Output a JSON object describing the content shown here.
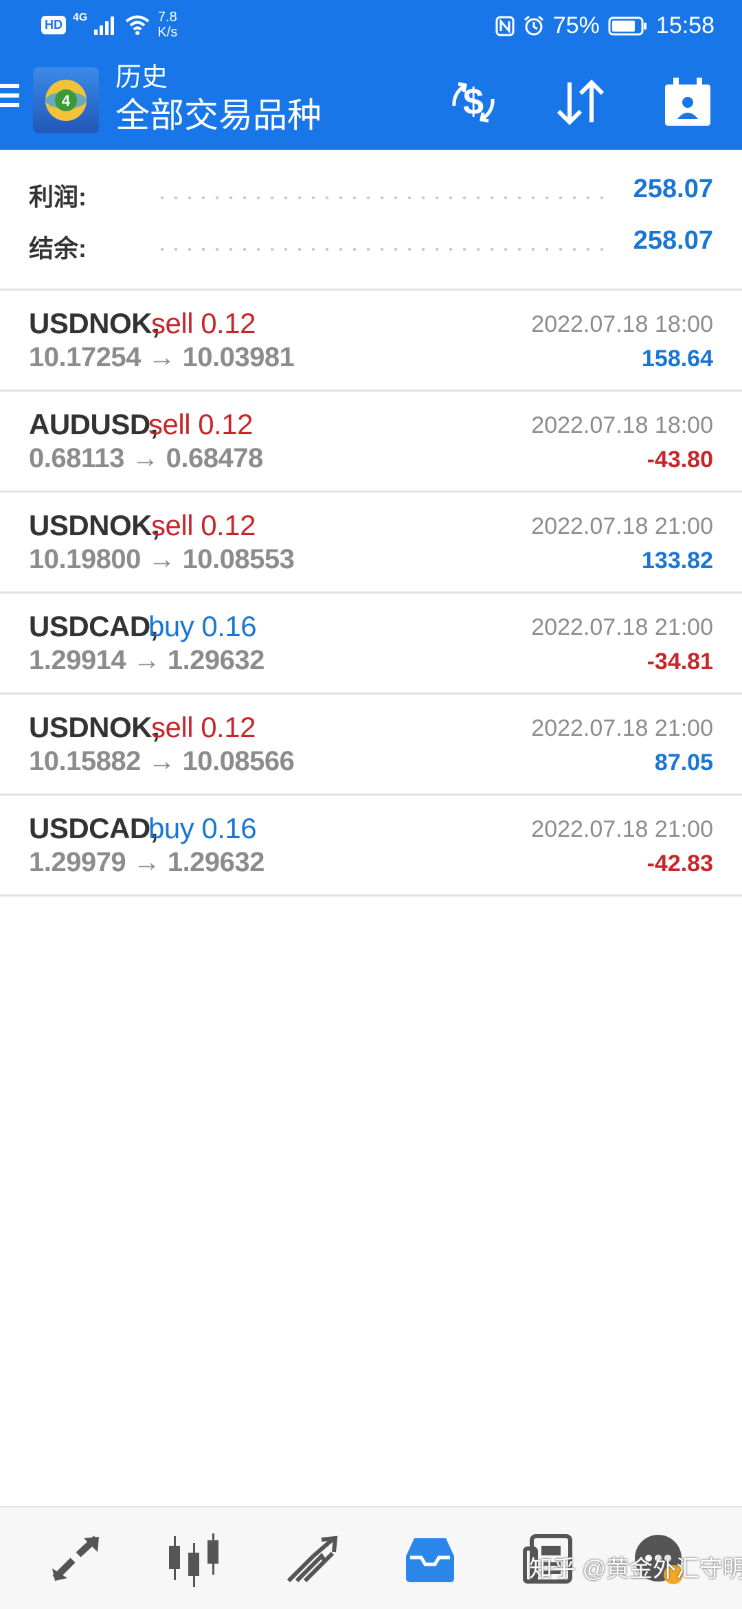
{
  "status_bar": {
    "hd_badge": "HD",
    "network": "4G",
    "speed_value": "7.8",
    "speed_unit": "K/s",
    "battery_percent": "75%",
    "time": "15:58"
  },
  "app_bar": {
    "title_small": "历史",
    "title_big": "全部交易品种",
    "colors": {
      "primary": "#1976e8"
    }
  },
  "summary": {
    "profit_label": "利润:",
    "profit_value": "258.07",
    "balance_label": "结余:",
    "balance_value": "258.07"
  },
  "trades": [
    {
      "symbol": "USDNOK,",
      "side": "sell 0.12",
      "side_type": "sell",
      "prices": "10.17254 → 10.03981",
      "datetime": "2022.07.18 18:00",
      "profit": "158.64",
      "profit_sign": "pos"
    },
    {
      "symbol": "AUDUSD,",
      "side": "sell 0.12",
      "side_type": "sell",
      "prices": "0.68113 → 0.68478",
      "datetime": "2022.07.18 18:00",
      "profit": "-43.80",
      "profit_sign": "neg"
    },
    {
      "symbol": "USDNOK,",
      "side": "sell 0.12",
      "side_type": "sell",
      "prices": "10.19800 → 10.08553",
      "datetime": "2022.07.18 21:00",
      "profit": "133.82",
      "profit_sign": "pos"
    },
    {
      "symbol": "USDCAD,",
      "side": "buy 0.16",
      "side_type": "buy",
      "prices": "1.29914 → 1.29632",
      "datetime": "2022.07.18 21:00",
      "profit": "-34.81",
      "profit_sign": "neg"
    },
    {
      "symbol": "USDNOK,",
      "side": "sell 0.12",
      "side_type": "sell",
      "prices": "10.15882 → 10.08566",
      "datetime": "2022.07.18 21:00",
      "profit": "87.05",
      "profit_sign": "pos"
    },
    {
      "symbol": "USDCAD,",
      "side": "buy 0.16",
      "side_type": "buy",
      "prices": "1.29979 → 1.29632",
      "datetime": "2022.07.18 21:00",
      "profit": "-42.83",
      "profit_sign": "neg"
    }
  ],
  "bottom_nav": {
    "items": [
      "quotes-icon",
      "chart-icon",
      "trade-icon",
      "history-icon",
      "news-icon",
      "chat-icon"
    ],
    "watermark": "知乎 @黄金外汇守明"
  }
}
